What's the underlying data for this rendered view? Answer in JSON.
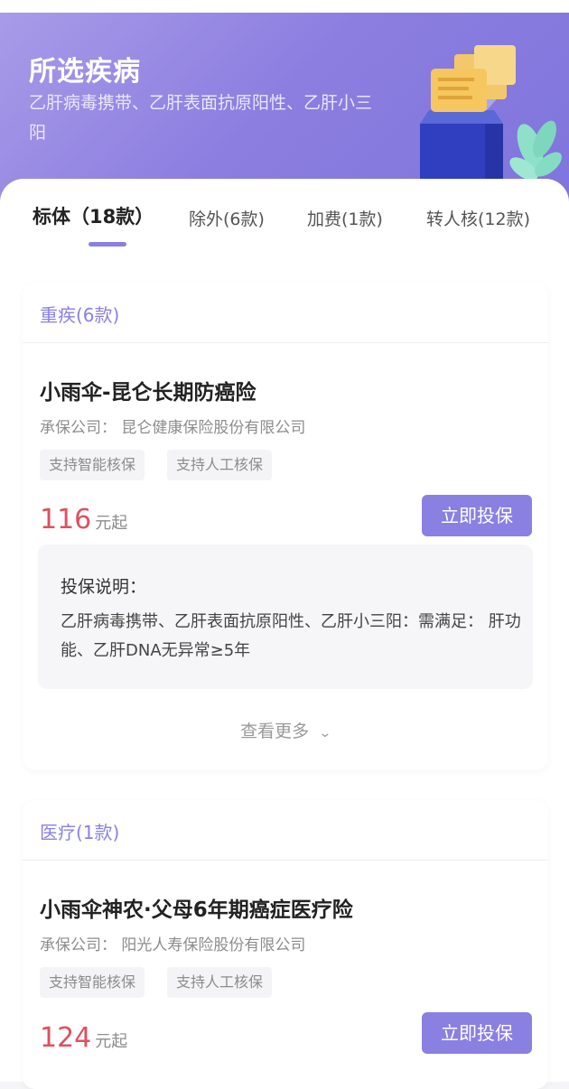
{
  "hero": {
    "title": "所选疾病",
    "subtitle": "乙肝病毒携带、乙肝表面抗原阳性、乙肝小三阳"
  },
  "tabs": [
    {
      "label": "标体（18款）",
      "active": true
    },
    {
      "label": "除外(6款)",
      "active": false
    },
    {
      "label": "加费(1款)",
      "active": false
    },
    {
      "label": "转人核(12款)",
      "active": false
    }
  ],
  "sections": [
    {
      "header": "重疾(6款)",
      "product": {
        "name": "小雨伞-昆仑长期防癌险",
        "company": "承保公司：  昆仑健康保险股份有限公司",
        "tags": [
          "支持智能核保",
          "支持人工核保"
        ],
        "price": "116",
        "price_unit": "元起",
        "buy_label": "立即投保",
        "note_title": "投保说明：",
        "note_body": "乙肝病毒携带、乙肝表面抗原阳性、乙肝小三阳：需满足：  肝功能、乙肝DNA无异常≥5年",
        "more_label": "查看更多"
      }
    },
    {
      "header": "医疗(1款)",
      "product": {
        "name": "小雨伞神农·父母6年期癌症医疗险",
        "company": "承保公司：  阳光人寿保险股份有限公司",
        "tags": [
          "支持智能核保",
          "支持人工核保"
        ],
        "price": "124",
        "price_unit": "元起",
        "buy_label": "立即投保"
      }
    }
  ],
  "colors": {
    "accent": "#8a80e2",
    "price": "#e04f5f",
    "hero_start": "#a89be8",
    "hero_end": "#7e74dc"
  }
}
